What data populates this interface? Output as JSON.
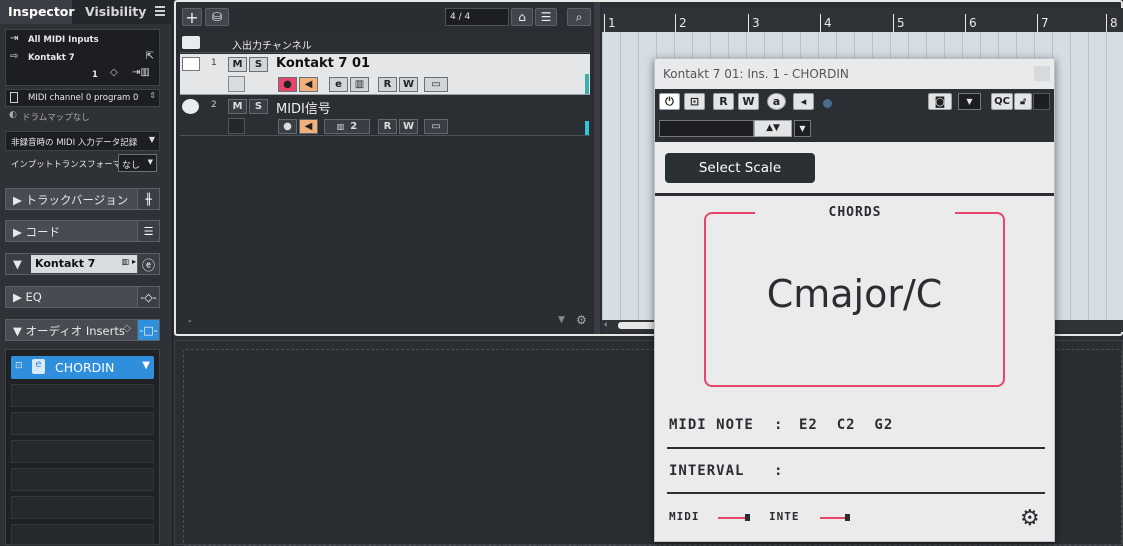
{
  "inspector": {
    "tabs": [
      "Inspector",
      "Visibility"
    ],
    "input_routing": "All MIDI Inputs",
    "output_routing": "Kontakt 7",
    "channel": "1",
    "program": "MIDI channel 0 program 0",
    "drum_map": "ドラムマップなし",
    "record_mode": "非録音時の MIDI 入力データ記録",
    "input_transformer_label": "インプットトランスフォーマー",
    "input_transformer_value": "なし",
    "sections": {
      "track_versions": "トラックバージョン",
      "chord": "コード",
      "instrument": "Kontakt 7",
      "eq": "EQ",
      "audio_inserts": "オーディオ Inserts"
    },
    "insert_slot_1": "CHORDIN"
  },
  "project": {
    "track_count": "4 / 4",
    "input_channel_header": "入出力チャンネル",
    "tracks": [
      {
        "number": "1",
        "name": "Kontakt 7 01",
        "m": "M",
        "s": "S",
        "r": "R",
        "w": "W",
        "e": "e"
      },
      {
        "number": "2",
        "name": "MIDI信号",
        "m": "M",
        "s": "S",
        "r": "R",
        "w": "W",
        "value": "2"
      }
    ],
    "bottom_marker": "-",
    "ruler_bars": [
      "1",
      "2",
      "3",
      "4",
      "5",
      "6",
      "7",
      "8"
    ]
  },
  "plugin": {
    "title": "Kontakt 7 01: Ins. 1 - CHORDIN",
    "r": "R",
    "w": "W",
    "a": "a",
    "qc": "QC",
    "select_scale": "Select Scale",
    "chords_label": "CHORDS",
    "chord": "Cmajor/C",
    "midi_note_label": "MIDI NOTE",
    "midi_note_sep": ":",
    "midi_notes": "E2  C2  G2",
    "interval_label": "INTERVAL",
    "interval_sep": ":",
    "midi_label": "MIDI",
    "inte_label": "INTE"
  },
  "colors": {
    "accent_blue": "#2f8fdc",
    "chord_box": "#e8456b",
    "plugin_dark": "#2b2e33"
  }
}
